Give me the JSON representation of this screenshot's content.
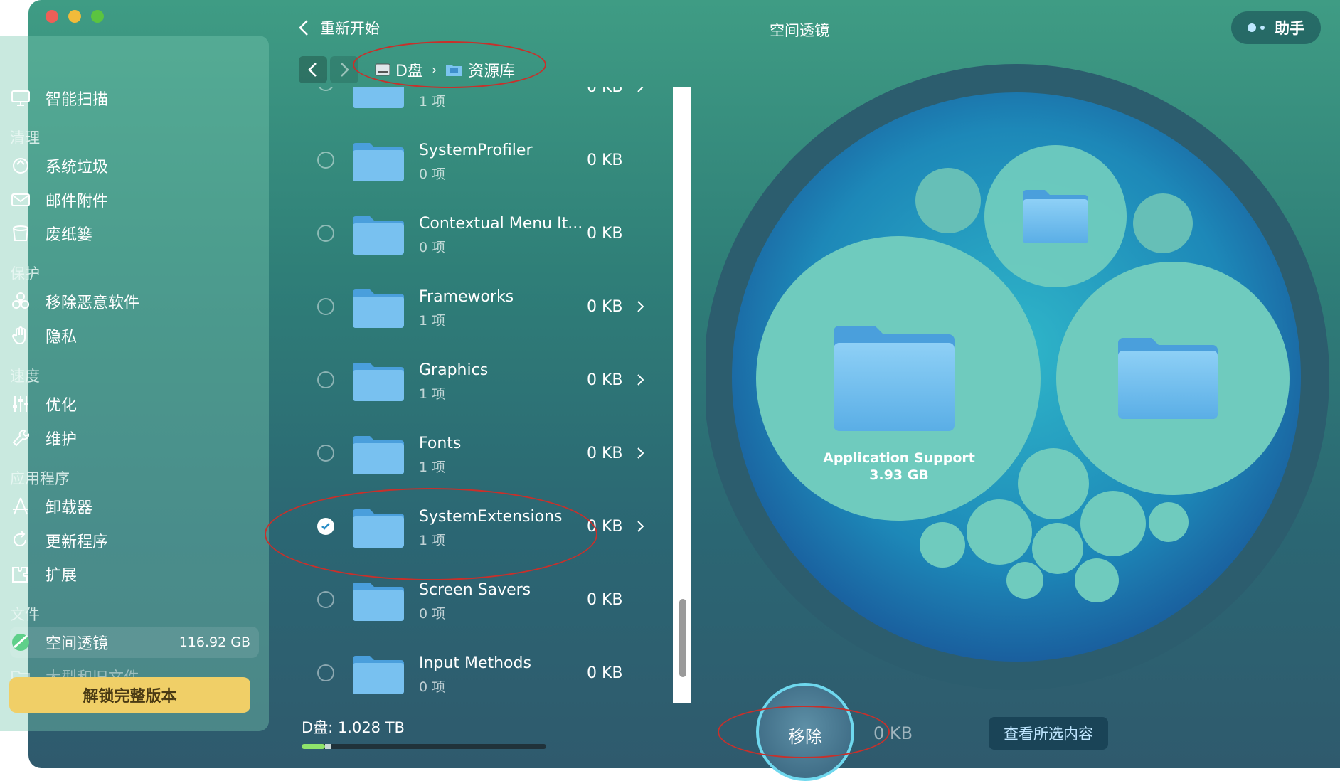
{
  "sidebar": {
    "smart_scan": "智能扫描",
    "sections": {
      "cleanup": "清理",
      "protection": "保护",
      "speed": "速度",
      "applications": "应用程序",
      "files": "文件"
    },
    "items": {
      "system_junk": "系统垃圾",
      "mail_attachments": "邮件附件",
      "trash_bins": "废纸篓",
      "malware_removal": "移除恶意软件",
      "privacy": "隐私",
      "optimization": "优化",
      "maintenance": "维护",
      "uninstaller": "卸载器",
      "updater": "更新程序",
      "extensions": "扩展",
      "space_lens": "空间透镜",
      "space_lens_size": "116.92 GB",
      "large_old_files": "大型和旧文件"
    },
    "unlock_label": "解锁完整版本"
  },
  "header": {
    "back_label": "重新开始",
    "title": "空间透镜",
    "assistant_label": "助手"
  },
  "breadcrumb": {
    "disk": "D盘",
    "separator": "›",
    "folder": "资源库"
  },
  "list": {
    "partial_top": {
      "count": "1 项",
      "size": "0 KB"
    },
    "rows": [
      {
        "name": "SystemProfiler",
        "count": "0 项",
        "size": "0 KB",
        "has_children": false,
        "checked": false
      },
      {
        "name": "Contextual Menu It...",
        "count": "0 项",
        "size": "0 KB",
        "has_children": false,
        "checked": false
      },
      {
        "name": "Frameworks",
        "count": "1 项",
        "size": "0 KB",
        "has_children": true,
        "checked": false
      },
      {
        "name": "Graphics",
        "count": "1 项",
        "size": "0 KB",
        "has_children": true,
        "checked": false
      },
      {
        "name": "Fonts",
        "count": "1 项",
        "size": "0 KB",
        "has_children": true,
        "checked": false
      },
      {
        "name": "SystemExtensions",
        "count": "1 项",
        "size": "0 KB",
        "has_children": true,
        "checked": true
      },
      {
        "name": "Screen Savers",
        "count": "0 项",
        "size": "0 KB",
        "has_children": false,
        "checked": false
      },
      {
        "name": "Input Methods",
        "count": "0 项",
        "size": "0 KB",
        "has_children": false,
        "checked": false
      }
    ]
  },
  "disk": {
    "label": "D盘: 1.028 TB",
    "used_fraction": 0.12
  },
  "bubble": {
    "label": "Application Support",
    "size": "3.93 GB"
  },
  "actions": {
    "remove_label": "移除",
    "selected_size": "0 KB",
    "view_selected_label": "查看所选内容"
  },
  "colors": {
    "accent": "#6fd8ee",
    "unlock": "#f0cf67",
    "folder": "#6cb4e8",
    "annotation": "#c8302b"
  }
}
